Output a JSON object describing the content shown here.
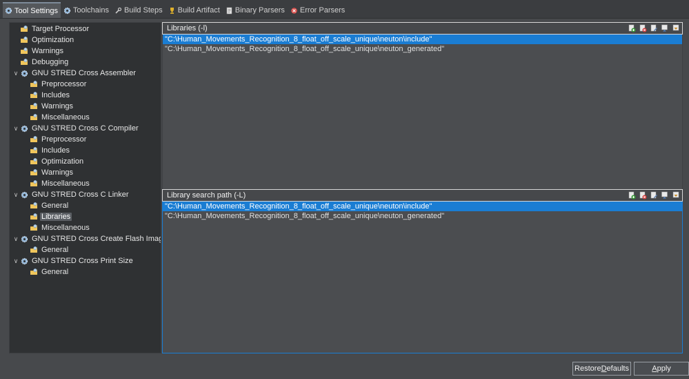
{
  "tabs": [
    {
      "label": "Tool Settings",
      "icon": "gear-icon",
      "active": true
    },
    {
      "label": "Toolchains",
      "icon": "gear-icon",
      "active": false
    },
    {
      "label": "Build Steps",
      "icon": "wrench-icon",
      "active": false
    },
    {
      "label": "Build Artifact",
      "icon": "trophy-icon",
      "active": false
    },
    {
      "label": "Binary Parsers",
      "icon": "document-icon",
      "active": false
    },
    {
      "label": "Error Parsers",
      "icon": "error-icon",
      "active": false
    }
  ],
  "tree": [
    {
      "label": "Target Processor",
      "level": 1,
      "icon": "folder-settings-icon"
    },
    {
      "label": "Optimization",
      "level": 1,
      "icon": "folder-settings-icon"
    },
    {
      "label": "Warnings",
      "level": 1,
      "icon": "folder-settings-icon"
    },
    {
      "label": "Debugging",
      "level": 1,
      "icon": "folder-settings-icon"
    },
    {
      "label": "GNU STRED Cross Assembler",
      "level": 0,
      "icon": "gear-icon",
      "expanded": true
    },
    {
      "label": "Preprocessor",
      "level": 2,
      "icon": "folder-settings-icon"
    },
    {
      "label": "Includes",
      "level": 2,
      "icon": "folder-settings-icon"
    },
    {
      "label": "Warnings",
      "level": 2,
      "icon": "folder-settings-icon"
    },
    {
      "label": "Miscellaneous",
      "level": 2,
      "icon": "folder-settings-icon"
    },
    {
      "label": "GNU STRED Cross C Compiler",
      "level": 0,
      "icon": "gear-icon",
      "expanded": true
    },
    {
      "label": "Preprocessor",
      "level": 2,
      "icon": "folder-settings-icon"
    },
    {
      "label": "Includes",
      "level": 2,
      "icon": "folder-settings-icon"
    },
    {
      "label": "Optimization",
      "level": 2,
      "icon": "folder-settings-icon"
    },
    {
      "label": "Warnings",
      "level": 2,
      "icon": "folder-settings-icon"
    },
    {
      "label": "Miscellaneous",
      "level": 2,
      "icon": "folder-settings-icon"
    },
    {
      "label": "GNU STRED Cross C Linker",
      "level": 0,
      "icon": "gear-icon",
      "expanded": true
    },
    {
      "label": "General",
      "level": 2,
      "icon": "folder-settings-icon"
    },
    {
      "label": "Libraries",
      "level": 2,
      "icon": "folder-settings-icon",
      "selected": true
    },
    {
      "label": "Miscellaneous",
      "level": 2,
      "icon": "folder-settings-icon"
    },
    {
      "label": "GNU STRED Cross Create Flash Image",
      "level": 0,
      "icon": "gear-icon",
      "expanded": true
    },
    {
      "label": "General",
      "level": 2,
      "icon": "folder-settings-icon"
    },
    {
      "label": "GNU STRED Cross Print Size",
      "level": 0,
      "icon": "gear-icon",
      "expanded": true
    },
    {
      "label": "General",
      "level": 2,
      "icon": "folder-settings-icon"
    }
  ],
  "libraries": {
    "title": "Libraries (-l)",
    "items": [
      "\"C:\\Human_Movements_Recognition_8_float_off_scale_unique\\neuton\\include\"",
      "\"C:\\Human_Movements_Recognition_8_float_off_scale_unique\\neuton_generated\""
    ],
    "selected_index": 0
  },
  "library_paths": {
    "title": "Library search path (-L)",
    "items": [
      "\"C:\\Human_Movements_Recognition_8_float_off_scale_unique\\neuton\\include\"",
      "\"C:\\Human_Movements_Recognition_8_float_off_scale_unique\\neuton_generated\""
    ],
    "selected_index": 0
  },
  "buttons": {
    "restore_prefix": "Restore ",
    "restore_accel": "D",
    "restore_suffix": "efaults",
    "apply_prefix": "",
    "apply_accel": "A",
    "apply_suffix": "pply"
  },
  "colors": {
    "selection": "#1a7dd3",
    "panel_bg": "#2f3133",
    "window_bg": "#47494c"
  }
}
